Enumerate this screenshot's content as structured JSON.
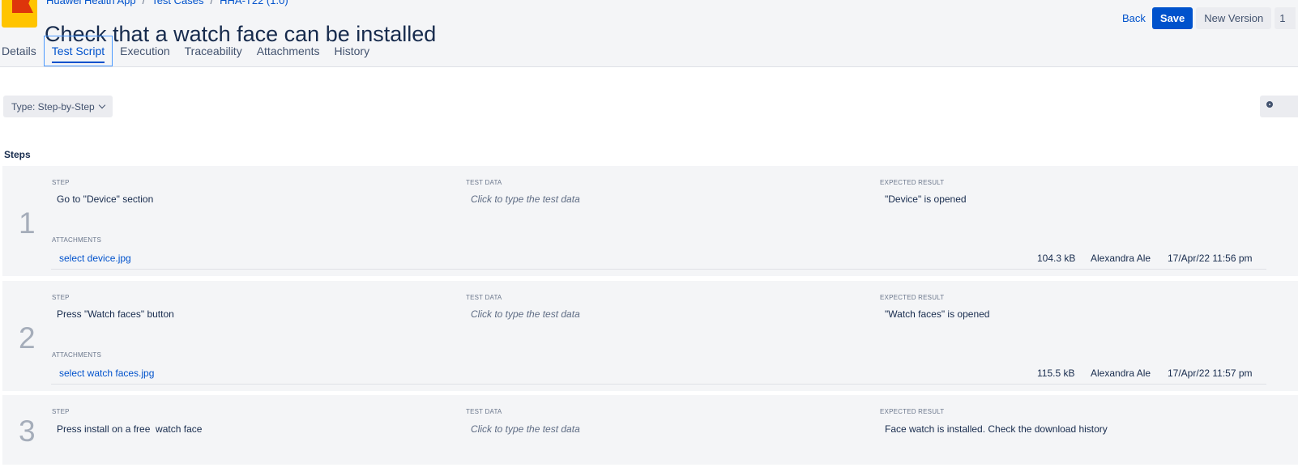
{
  "breadcrumb": [
    "Huawei Health App",
    "Test Cases",
    "HHA-T22 (1.0)"
  ],
  "page_title": "Check that a watch face can be installed",
  "actions": {
    "back": "Back",
    "save": "Save",
    "new_version": "New Version",
    "more": "1"
  },
  "tabs": [
    "Details",
    "Test Script",
    "Execution",
    "Traceability",
    "Attachments",
    "History"
  ],
  "active_tab": "Test Script",
  "type_select": "Type: Step-by-Step",
  "steps_heading": "Steps",
  "labels": {
    "step": "STEP",
    "test_data": "TEST DATA",
    "expected": "EXPECTED RESULT",
    "attachments": "ATTACHMENTS"
  },
  "steps": [
    {
      "number": "1",
      "step": "Go to \"Device\" section",
      "test_data": "Click to type the test data",
      "expected": "\"Device\" is opened",
      "attachment": {
        "name": "select device.jpg",
        "size": "104.3 kB",
        "author": "Alexandra Ale",
        "date": "17/Apr/22 11:56 pm"
      }
    },
    {
      "number": "2",
      "step": "Press \"Watch faces\" button",
      "test_data": "Click to type the test data",
      "expected": "\"Watch faces\" is opened",
      "attachment": {
        "name": "select watch faces.jpg",
        "size": "115.5 kB",
        "author": "Alexandra Ale",
        "date": "17/Apr/22 11:57 pm"
      }
    },
    {
      "number": "3",
      "step": "Press install on a free  watch face",
      "test_data": "Click to type the test data",
      "expected": "Face watch is installed. Check the download history"
    }
  ]
}
